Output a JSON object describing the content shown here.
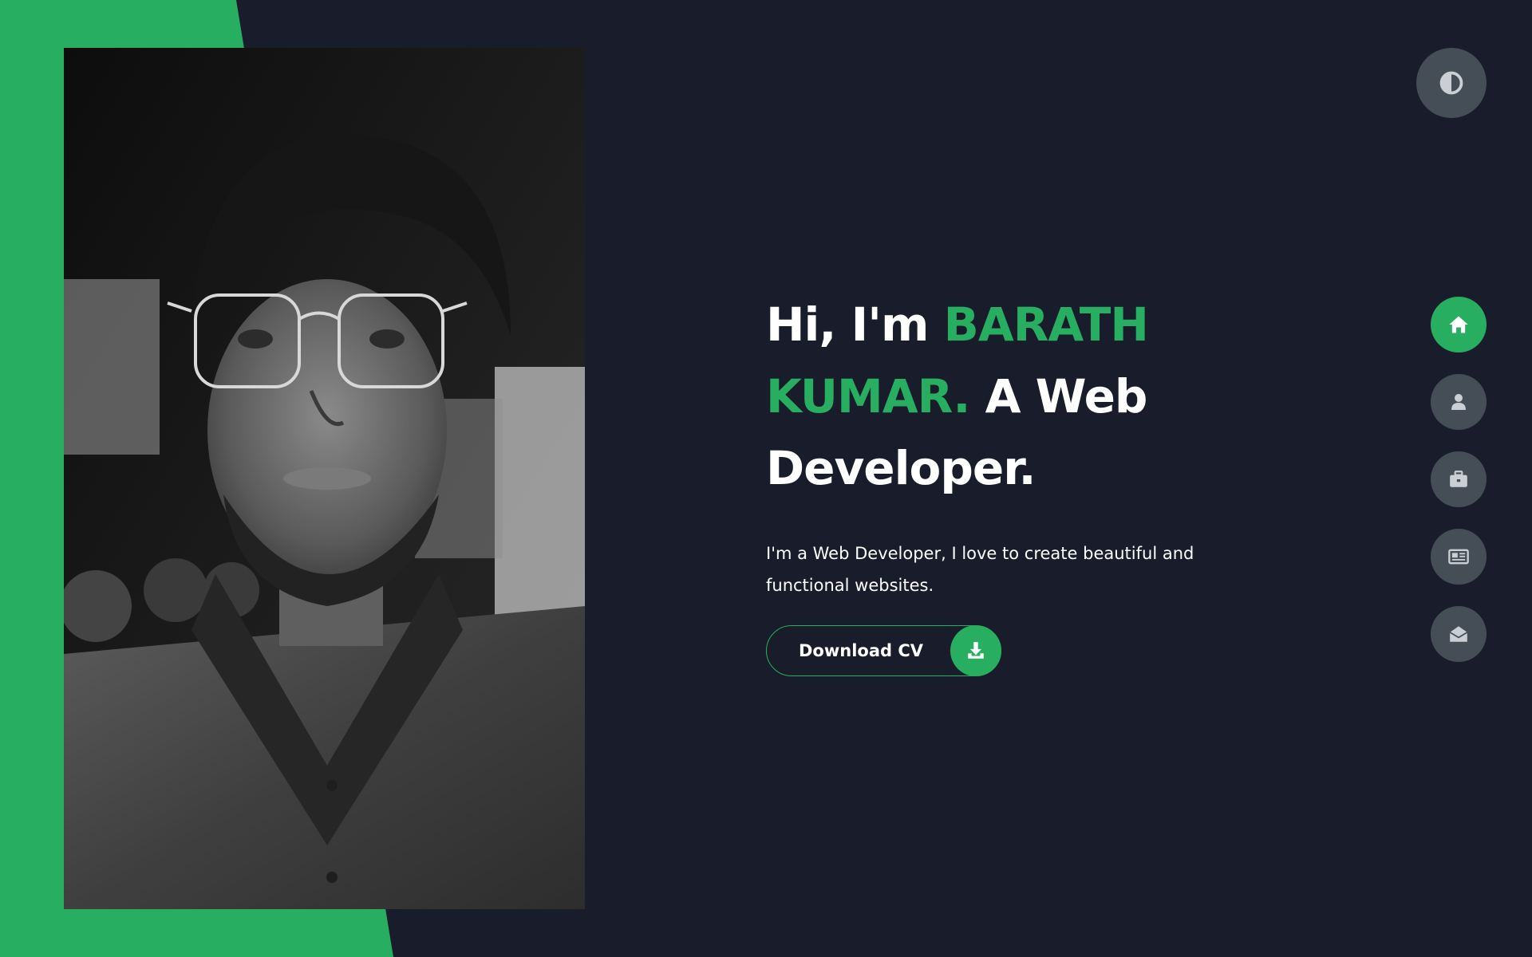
{
  "hero": {
    "greeting": "Hi, I'm ",
    "name": "BARATH KUMAR.",
    "role": " A Web Developer.",
    "intro": "I'm a Web Developer, I love to create beautiful and functional websites.",
    "cv_button_label": "Download CV",
    "cv_button_icon": "download-icon"
  },
  "theme_toggle": {
    "icon": "contrast-icon"
  },
  "side_nav": {
    "items": [
      {
        "icon": "home-icon",
        "active": true
      },
      {
        "icon": "user-icon",
        "active": false
      },
      {
        "icon": "briefcase-icon",
        "active": false
      },
      {
        "icon": "newspaper-icon",
        "active": false
      },
      {
        "icon": "envelope-open-icon",
        "active": false
      }
    ]
  },
  "colors": {
    "accent": "#27ae60",
    "background": "#191d2b",
    "button_gray": "#454e56",
    "text": "#ffffff"
  }
}
